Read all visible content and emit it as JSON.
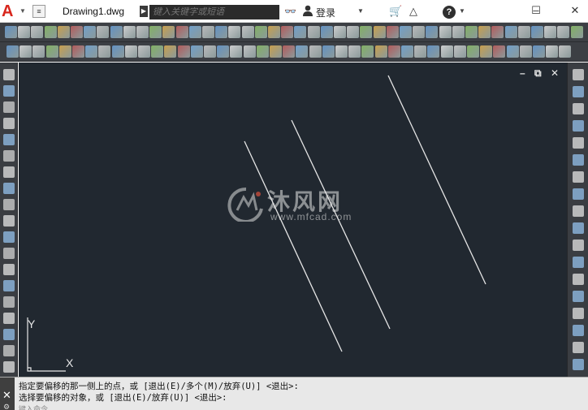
{
  "window": {
    "app_logo": "A",
    "doc_tab": "Drawing1.dwg",
    "search_placeholder": "键入关键字或短语",
    "login_label": "登录",
    "help_label": "?",
    "minimize": "–",
    "maximize": "☐",
    "close": "✕"
  },
  "canvas": {
    "viewport_controls": [
      "–",
      "⧉",
      "✕"
    ],
    "watermark_title": "沐风网",
    "watermark_url": "www.mfcad.com",
    "ucs_x": "X",
    "ucs_y": "Y"
  },
  "command": {
    "history": [
      "指定要偏移的那一侧上的点，或 [退出(E)/多个(M)/放弃(U)] <退出>:",
      "选择要偏移的对象，或 [退出(E)/放弃(U)] <退出>:"
    ],
    "input_placeholder": "键入命令"
  },
  "colors": {
    "canvas_bg": "#212830",
    "toolbar_bg": "#3c3f44",
    "line_color": "#e6e6e6",
    "accent_red": "#d8261c"
  }
}
